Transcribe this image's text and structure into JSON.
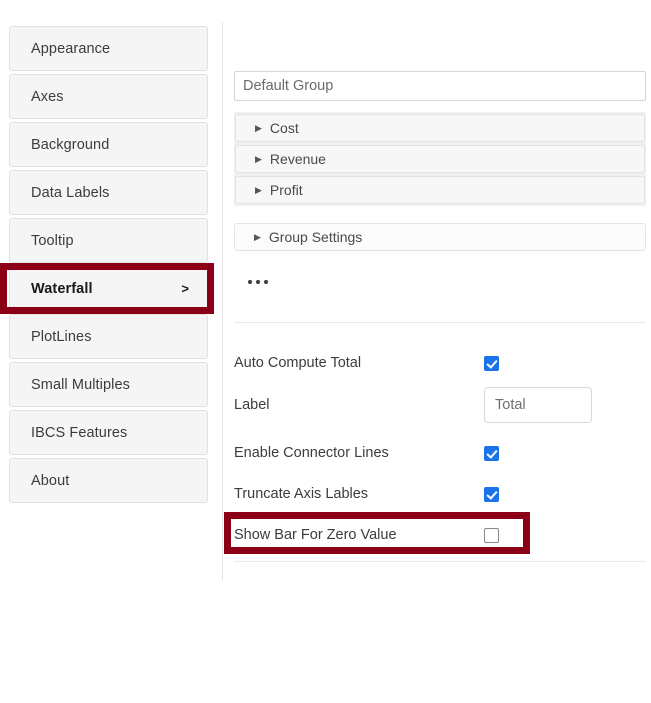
{
  "sidebar": {
    "items": [
      {
        "label": "Appearance",
        "active": false,
        "chevron": ""
      },
      {
        "label": "Axes",
        "active": false,
        "chevron": ""
      },
      {
        "label": "Background",
        "active": false,
        "chevron": ""
      },
      {
        "label": "Data Labels",
        "active": false,
        "chevron": ""
      },
      {
        "label": "Tooltip",
        "active": false,
        "chevron": ""
      },
      {
        "label": "Waterfall",
        "active": true,
        "chevron": ">"
      },
      {
        "label": "PlotLines",
        "active": false,
        "chevron": ""
      },
      {
        "label": "Small Multiples",
        "active": false,
        "chevron": ""
      },
      {
        "label": "IBCS Features",
        "active": false,
        "chevron": ""
      },
      {
        "label": "About",
        "active": false,
        "chevron": ""
      }
    ]
  },
  "panel": {
    "group_name": {
      "value": "Default Group",
      "placeholder": "Default Group"
    },
    "accordions": [
      {
        "label": "Cost",
        "arrow": "▶"
      },
      {
        "label": "Revenue",
        "arrow": "▶"
      },
      {
        "label": "Profit",
        "arrow": "▶"
      }
    ],
    "group_settings": {
      "label": "Group Settings",
      "arrow": "▶"
    },
    "overflow_menu": {
      "label": "..."
    },
    "options": [
      {
        "label": "Auto Compute Total",
        "control": "checkbox",
        "checked": true
      },
      {
        "label": "Label",
        "control": "textbox",
        "value": "Total",
        "placeholder": "Total"
      },
      {
        "label": "Enable Connector Lines",
        "control": "checkbox",
        "checked": true
      },
      {
        "label": "Truncate Axis Lables",
        "control": "checkbox",
        "checked": true
      },
      {
        "label": "Show Bar For Zero Value",
        "control": "checkbox",
        "checked": false
      }
    ]
  },
  "highlights": [
    {
      "target": "Waterfall",
      "color": "#8b0016"
    },
    {
      "target": "Show Bar For Zero Value",
      "color": "#8b0016"
    }
  ],
  "colors": {
    "highlight": "#8b0016",
    "checkbox_accent": "#1a73e8",
    "nav_background": "#f5f5f5",
    "nav_border": "#e0e0e0",
    "divider": "#e4e4e4"
  }
}
